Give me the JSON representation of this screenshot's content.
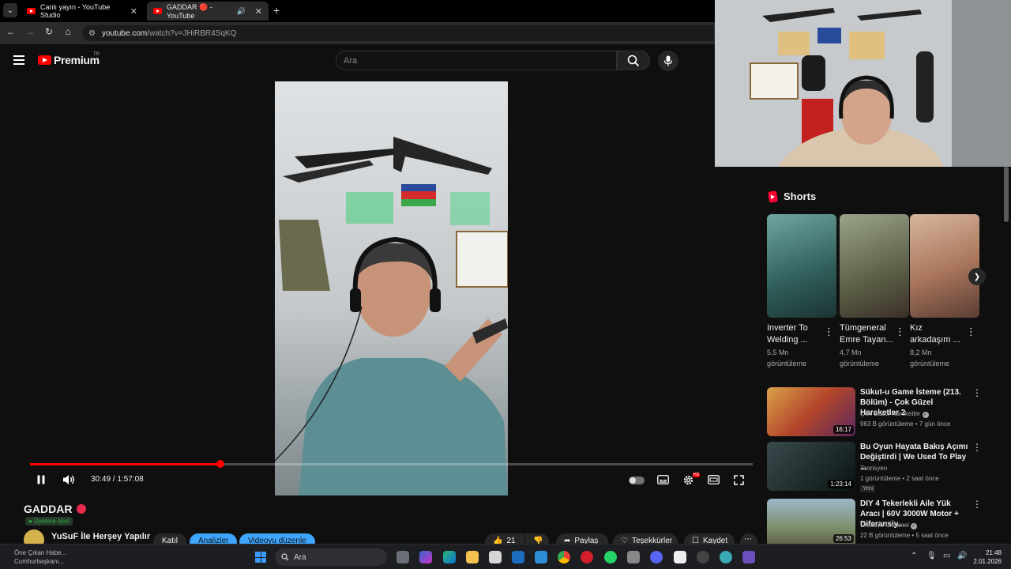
{
  "browser": {
    "tabs": [
      {
        "title": "Canlı yayın - YouTube Studio"
      },
      {
        "title": "GADDAR 🔴 - YouTube"
      }
    ],
    "url_domain": "youtube.com",
    "url_path": "/watch?v=JHiRBR4SqKQ"
  },
  "header": {
    "logo_text": "Premium",
    "region": "TR",
    "search_placeholder": "Ara"
  },
  "player": {
    "time_display": "30:49 / 1:57:08",
    "progress_fraction": 0.2632,
    "colors": {
      "progress": "#ff0000",
      "accent_blue": "#3ea6ff"
    }
  },
  "video": {
    "title": "GADDAR",
    "members_badge": "Üyelere özel",
    "channel_name": "YuSuF İle Herşey Yapılır",
    "join_label": "Katıl",
    "analytics_label": "Analizler",
    "edit_label": "Videoyu düzenle",
    "like_count": "21",
    "share_label": "Paylaş",
    "thanks_label": "Teşekkürler",
    "save_label": "Kaydet"
  },
  "sidebar": {
    "shorts_heading": "Shorts",
    "shorts": [
      {
        "title": "Inverter To Welding ...",
        "views": "5,5 Mn görüntüleme"
      },
      {
        "title": "Tümgeneral Emre Tayan...",
        "views": "4,7 Mn görüntüleme"
      },
      {
        "title": "Kız arkadaşım ...",
        "views": "8,2 Mn görüntüleme"
      }
    ],
    "recommendations": [
      {
        "title": "Sükut-u Game İsteme (213. Bölüm) - Çok Güzel Hareketler 2",
        "channel": "Çok Güzel Hareketler",
        "meta": "963 B görüntüleme • 7 gün önce",
        "duration": "16:17",
        "badge": ""
      },
      {
        "title": "Bu Oyun Hayata Bakış Açımı Değiştirdi | We Used To Play ...",
        "channel": "Teorisyen",
        "meta": "1 görüntüleme • 2 saat önce",
        "duration": "1:23:14",
        "badge": "Yeni"
      },
      {
        "title": "DIY 4 Tekerlekli Aile Yük Aracı | 60V 3000W Motor + Diferansiy...",
        "channel": "Creative Channel",
        "meta": "22 B görüntüleme • 5 saat önce",
        "duration": "26:53",
        "badge": ""
      }
    ]
  },
  "taskbar": {
    "weather_line1": "Öne Çıkan Habe...",
    "weather_line2": "Cumhurbaşkanı...",
    "search_label": "Ara",
    "time": "21:48",
    "date": "2.01.2026"
  }
}
